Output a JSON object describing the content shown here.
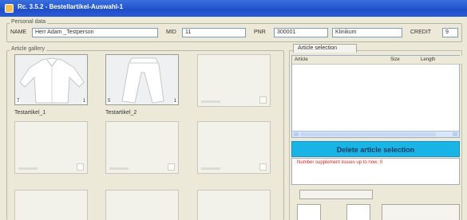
{
  "window": {
    "title": "Rc. 3.5.2 - Bestellartikel-Auswahl-1"
  },
  "personal": {
    "legend": "Personal data",
    "name_label": "NAME",
    "name_value": "Herr Adam _Testperson",
    "mid_label": "MID",
    "mid_value": "11",
    "pnr_label": "PNR",
    "pnr_value": "300001",
    "location_value": "Klinikum",
    "credit_label": "CREDIT",
    "credit_value": "9"
  },
  "gallery": {
    "legend": "Article gallery",
    "items": [
      {
        "caption": "Testartikel_1",
        "count_left": "7",
        "count_right": "1"
      },
      {
        "caption": "Testartikel_2",
        "count_left": "5",
        "count_right": "1"
      }
    ]
  },
  "selection": {
    "tab_label": "Article selection",
    "columns": [
      "Article",
      "Size",
      "Length"
    ],
    "delete_label": "Delete article selection",
    "message": "Number supplement issues up to now: 0"
  }
}
